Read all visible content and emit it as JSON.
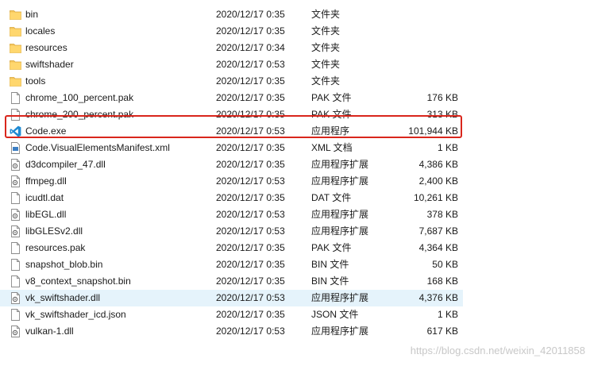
{
  "files": [
    {
      "name": "bin",
      "date": "2020/12/17 0:35",
      "type": "文件夹",
      "size": "",
      "icon": "folder-icon"
    },
    {
      "name": "locales",
      "date": "2020/12/17 0:35",
      "type": "文件夹",
      "size": "",
      "icon": "folder-icon"
    },
    {
      "name": "resources",
      "date": "2020/12/17 0:34",
      "type": "文件夹",
      "size": "",
      "icon": "folder-icon"
    },
    {
      "name": "swiftshader",
      "date": "2020/12/17 0:53",
      "type": "文件夹",
      "size": "",
      "icon": "folder-icon"
    },
    {
      "name": "tools",
      "date": "2020/12/17 0:35",
      "type": "文件夹",
      "size": "",
      "icon": "folder-icon"
    },
    {
      "name": "chrome_100_percent.pak",
      "date": "2020/12/17 0:35",
      "type": "PAK 文件",
      "size": "176 KB",
      "icon": "file-icon"
    },
    {
      "name": "chrome_200_percent.pak",
      "date": "2020/12/17 0:35",
      "type": "PAK 文件",
      "size": "313 KB",
      "icon": "file-icon"
    },
    {
      "name": "Code.exe",
      "date": "2020/12/17 0:53",
      "type": "应用程序",
      "size": "101,944 KB",
      "icon": "vscode-icon"
    },
    {
      "name": "Code.VisualElementsManifest.xml",
      "date": "2020/12/17 0:35",
      "type": "XML 文档",
      "size": "1 KB",
      "icon": "xml-icon"
    },
    {
      "name": "d3dcompiler_47.dll",
      "date": "2020/12/17 0:35",
      "type": "应用程序扩展",
      "size": "4,386 KB",
      "icon": "dll-icon"
    },
    {
      "name": "ffmpeg.dll",
      "date": "2020/12/17 0:53",
      "type": "应用程序扩展",
      "size": "2,400 KB",
      "icon": "dll-icon"
    },
    {
      "name": "icudtl.dat",
      "date": "2020/12/17 0:35",
      "type": "DAT 文件",
      "size": "10,261 KB",
      "icon": "file-icon"
    },
    {
      "name": "libEGL.dll",
      "date": "2020/12/17 0:53",
      "type": "应用程序扩展",
      "size": "378 KB",
      "icon": "dll-icon"
    },
    {
      "name": "libGLESv2.dll",
      "date": "2020/12/17 0:53",
      "type": "应用程序扩展",
      "size": "7,687 KB",
      "icon": "dll-icon"
    },
    {
      "name": "resources.pak",
      "date": "2020/12/17 0:35",
      "type": "PAK 文件",
      "size": "4,364 KB",
      "icon": "file-icon"
    },
    {
      "name": "snapshot_blob.bin",
      "date": "2020/12/17 0:35",
      "type": "BIN 文件",
      "size": "50 KB",
      "icon": "file-icon"
    },
    {
      "name": "v8_context_snapshot.bin",
      "date": "2020/12/17 0:35",
      "type": "BIN 文件",
      "size": "168 KB",
      "icon": "file-icon"
    },
    {
      "name": "vk_swiftshader.dll",
      "date": "2020/12/17 0:53",
      "type": "应用程序扩展",
      "size": "4,376 KB",
      "icon": "dll-icon"
    },
    {
      "name": "vk_swiftshader_icd.json",
      "date": "2020/12/17 0:35",
      "type": "JSON 文件",
      "size": "1 KB",
      "icon": "file-icon"
    },
    {
      "name": "vulkan-1.dll",
      "date": "2020/12/17 0:53",
      "type": "应用程序扩展",
      "size": "617 KB",
      "icon": "dll-icon"
    }
  ],
  "highlighted_file": "Code.exe",
  "hovered_file": "vk_swiftshader.dll",
  "watermark": "https://blog.csdn.net/weixin_42011858",
  "colors": {
    "highlight_border": "#d9261c",
    "hover_bg": "#e5f3fb",
    "folder": "#f4c55a",
    "vscode": "#1f8ad2"
  }
}
